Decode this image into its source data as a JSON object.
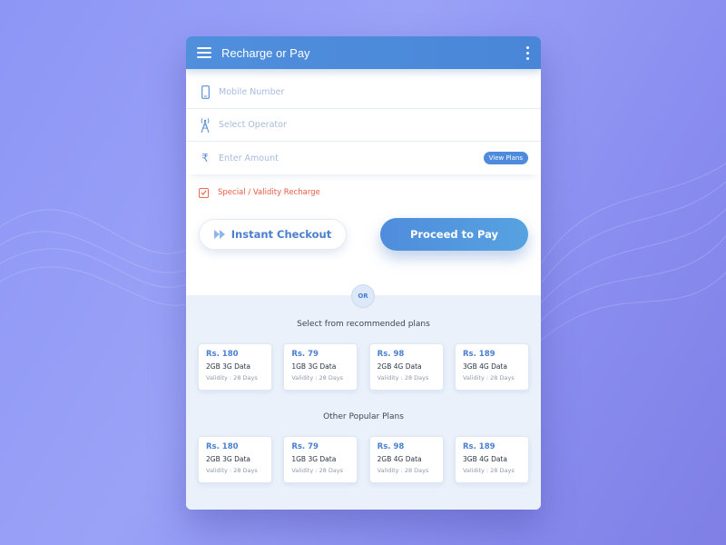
{
  "colors": {
    "accent": "#4a86d8",
    "warning": "#e95b48",
    "background": "#8d96f5"
  },
  "appbar": {
    "title": "Recharge or Pay",
    "menu_icon": "hamburger-icon",
    "more_icon": "more-vert-icon"
  },
  "form": {
    "mobile": {
      "icon": "phone-icon",
      "placeholder": "Mobile Number"
    },
    "operator": {
      "icon": "tower-icon",
      "placeholder": "Select Operator"
    },
    "amount": {
      "icon": "rupee-icon",
      "symbol": "₹",
      "placeholder": "Enter Amount",
      "view_plans": "View Plans"
    },
    "special": {
      "label": "Special / Validity Recharge",
      "checked": true
    }
  },
  "buttons": {
    "instant": "Instant Checkout",
    "proceed": "Proceed to Pay"
  },
  "divider": {
    "label": "OR"
  },
  "recommended": {
    "title": "Select from recommended plans",
    "plans": [
      {
        "price": "Rs. 180",
        "data": "2GB 3G Data",
        "validity": "Validity : 28 Days"
      },
      {
        "price": "Rs. 79",
        "data": "1GB 3G Data",
        "validity": "Validity : 28 Days"
      },
      {
        "price": "Rs. 98",
        "data": "2GB 4G Data",
        "validity": "Validity : 28 Days"
      },
      {
        "price": "Rs. 189",
        "data": "3GB 4G Data",
        "validity": "Validity : 28 Days"
      }
    ]
  },
  "popular": {
    "title": "Other Popular Plans",
    "plans": [
      {
        "price": "Rs. 180",
        "data": "2GB 3G Data",
        "validity": "Validity : 28 Days"
      },
      {
        "price": "Rs. 79",
        "data": "1GB 3G Data",
        "validity": "Validity : 28 Days"
      },
      {
        "price": "Rs. 98",
        "data": "2GB 4G Data",
        "validity": "Validity : 28 Days"
      },
      {
        "price": "Rs. 189",
        "data": "3GB 4G Data",
        "validity": "Validity : 28 Days"
      }
    ]
  }
}
